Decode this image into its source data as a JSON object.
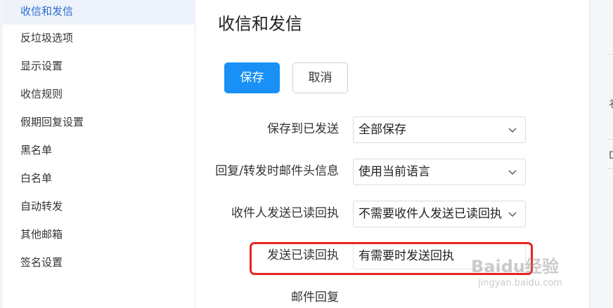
{
  "sidebar": {
    "items": [
      {
        "label": "收信和发信",
        "active": true
      },
      {
        "label": "反垃圾选项"
      },
      {
        "label": "显示设置"
      },
      {
        "label": "收信规则"
      },
      {
        "label": "假期回复设置"
      },
      {
        "label": "黑名单"
      },
      {
        "label": "白名单"
      },
      {
        "label": "自动转发"
      },
      {
        "label": "其他邮箱"
      },
      {
        "label": "签名设置"
      }
    ]
  },
  "main": {
    "title": "收信和发信",
    "save_label": "保存",
    "cancel_label": "取消",
    "rows": [
      {
        "label": "保存到已发送",
        "value": "全部保存",
        "has_dropdown": true
      },
      {
        "label": "回复/转发时邮件头信息",
        "value": "使用当前语言",
        "has_dropdown": true
      },
      {
        "label": "收件人发送已读回执",
        "value": "不需要收件人发送已读回执",
        "has_dropdown": true
      },
      {
        "label": "发送已读回执",
        "value": "有需要时发送回执",
        "has_dropdown": false
      },
      {
        "label": "邮件回复"
      }
    ]
  },
  "right_strip": {
    "glyph_1": "衤",
    "glyph_2": "D"
  },
  "watermark": {
    "text": "Baidu经验",
    "sub": "jingyan.baidu.com"
  },
  "colors": {
    "primary": "#1890f5",
    "active_bg": "#eef3fb",
    "active_text": "#2d6ccf",
    "highlight": "#e8231f"
  }
}
